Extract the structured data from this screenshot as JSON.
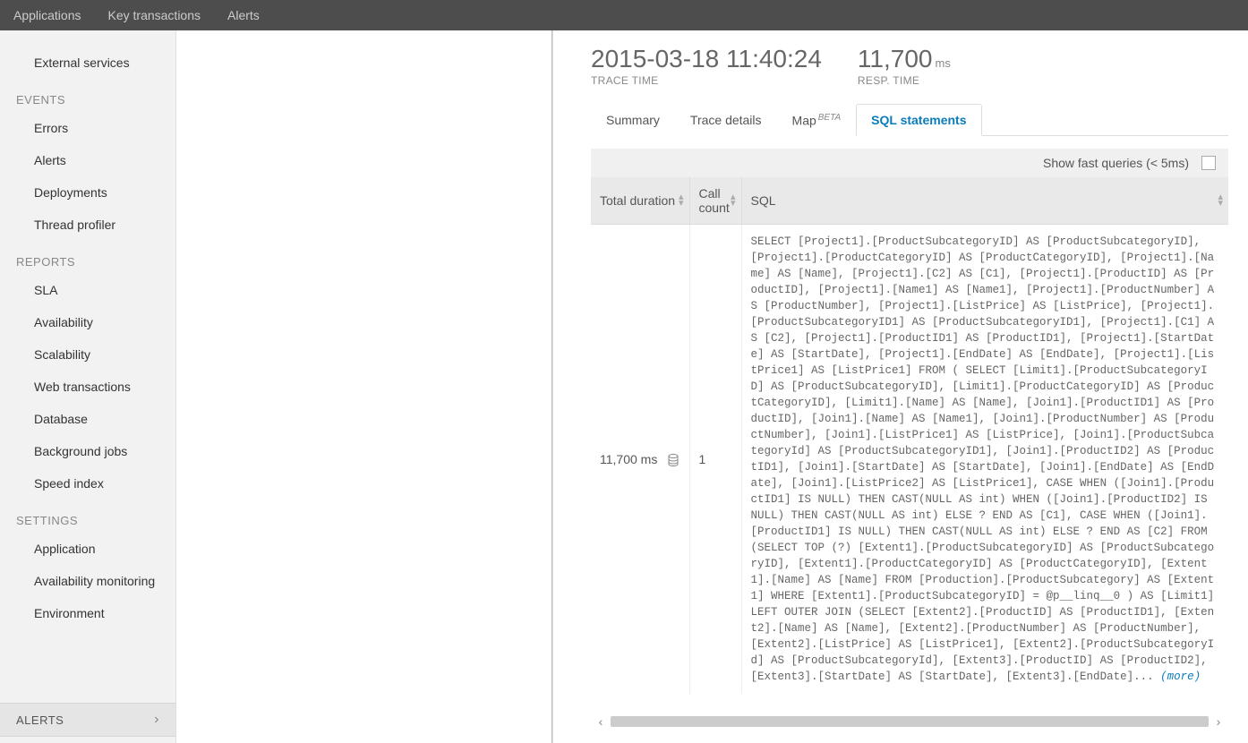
{
  "topnav": {
    "items": [
      "Applications",
      "Key transactions",
      "Alerts"
    ]
  },
  "sidebar": {
    "preItems": [
      "External services"
    ],
    "groups": [
      {
        "heading": "EVENTS",
        "items": [
          "Errors",
          "Alerts",
          "Deployments",
          "Thread profiler"
        ]
      },
      {
        "heading": "REPORTS",
        "items": [
          "SLA",
          "Availability",
          "Scalability",
          "Web transactions",
          "Database",
          "Background jobs",
          "Speed index"
        ]
      },
      {
        "heading": "SETTINGS",
        "items": [
          "Application",
          "Availability monitoring",
          "Environment"
        ]
      }
    ],
    "footer": "ALERTS"
  },
  "metrics": {
    "trace_time": {
      "value": "2015-03-18 11:40:24",
      "label": "TRACE TIME"
    },
    "resp_time": {
      "value": "11,700",
      "unit": "ms",
      "label": "RESP. TIME"
    }
  },
  "tabs": {
    "summary": "Summary",
    "trace_details": "Trace details",
    "map": "Map",
    "map_badge": "BETA",
    "sql": "SQL statements"
  },
  "fast_queries_label": "Show fast queries (< 5ms)",
  "columns": {
    "duration": "Total duration",
    "count": "Call count",
    "sql": "SQL"
  },
  "row": {
    "duration": "11,700 ms",
    "count": "1",
    "sql": "SELECT [Project1].[ProductSubcategoryID] AS [ProductSubcategoryID], [Project1].[ProductCategoryID] AS [ProductCategoryID], [Project1].[Name] AS [Name], [Project1].[C2] AS [C1], [Project1].[ProductID] AS [ProductID], [Project1].[Name1] AS [Name1], [Project1].[ProductNumber] AS [ProductNumber], [Project1].[ListPrice] AS [ListPrice], [Project1].[ProductSubcategoryID1] AS [ProductSubcategoryID1], [Project1].[C1] AS [C2], [Project1].[ProductID1] AS [ProductID1], [Project1].[StartDate] AS [StartDate], [Project1].[EndDate] AS [EndDate], [Project1].[ListPrice1] AS [ListPrice1] FROM ( SELECT [Limit1].[ProductSubcategoryID] AS [ProductSubcategoryID], [Limit1].[ProductCategoryID] AS [ProductCategoryID], [Limit1].[Name] AS [Name], [Join1].[ProductID1] AS [ProductID], [Join1].[Name] AS [Name1], [Join1].[ProductNumber] AS [ProductNumber], [Join1].[ListPrice1] AS [ListPrice], [Join1].[ProductSubcategoryId] AS [ProductSubcategoryID1], [Join1].[ProductID2] AS [ProductID1], [Join1].[StartDate] AS [StartDate], [Join1].[EndDate] AS [EndDate], [Join1].[ListPrice2] AS [ListPrice1], CASE WHEN ([Join1].[ProductID1] IS NULL) THEN CAST(NULL AS int) WHEN ([Join1].[ProductID2] IS NULL) THEN CAST(NULL AS int) ELSE ? END AS [C1], CASE WHEN ([Join1].[ProductID1] IS NULL) THEN CAST(NULL AS int) ELSE ? END AS [C2] FROM (SELECT TOP (?) [Extent1].[ProductSubcategoryID] AS [ProductSubcategoryID], [Extent1].[ProductCategoryID] AS [ProductCategoryID], [Extent1].[Name] AS [Name] FROM [Production].[ProductSubcategory] AS [Extent1] WHERE [Extent1].[ProductSubcategoryID] = @p__linq__0 ) AS [Limit1] LEFT OUTER JOIN (SELECT [Extent2].[ProductID] AS [ProductID1], [Extent2].[Name] AS [Name], [Extent2].[ProductNumber] AS [ProductNumber], [Extent2].[ListPrice] AS [ListPrice1], [Extent2].[ProductSubcategoryId] AS [ProductSubcategoryId], [Extent3].[ProductID] AS [ProductID2], [Extent3].[StartDate] AS [StartDate], [Extent3].[EndDate]... ",
    "more": "(more)"
  }
}
